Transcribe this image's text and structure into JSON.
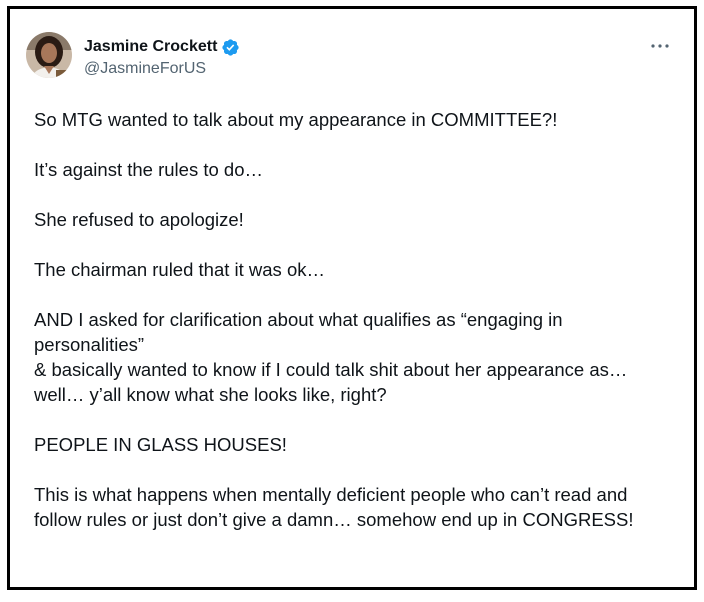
{
  "tweet": {
    "author": {
      "display_name": "Jasmine Crockett",
      "handle": "@JasmineForUS",
      "verified": true,
      "verified_icon": "verified-badge-icon",
      "verified_color": "#1d9bf0"
    },
    "more_icon": "more-options-icon",
    "paragraphs": [
      "So MTG wanted to talk about my appearance in COMMITTEE?!",
      "It’s against the rules to do…",
      "She refused to apologize!",
      "The chairman ruled that it was ok…",
      "AND I asked for clarification about what qualifies as “engaging in\npersonalities”\n& basically wanted to know if I could talk shit about her appearance as…\nwell… y’all know what she looks like, right?",
      "PEOPLE IN GLASS HOUSES!",
      "This is what happens when mentally deficient people who can’t read and\nfollow rules or just don’t give a damn… somehow end up in CONGRESS!"
    ]
  },
  "colors": {
    "text": "#0f1419",
    "secondary": "#536471",
    "frame_border": "#000000"
  }
}
